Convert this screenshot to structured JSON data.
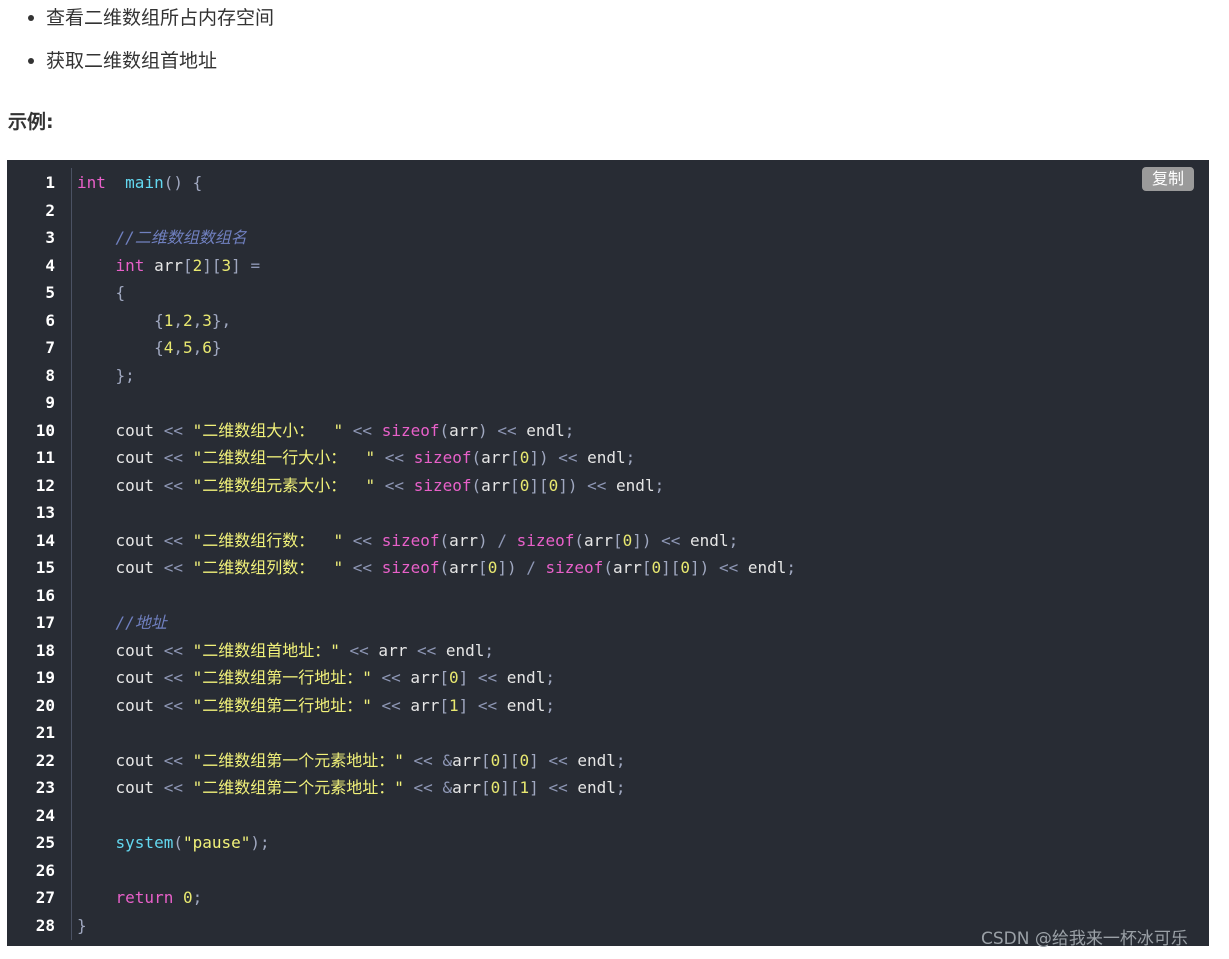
{
  "bullets": [
    "查看二维数组所占内存空间",
    "获取二维数组首地址"
  ],
  "heading": "示例:",
  "code": {
    "copy_label": "复制",
    "line_numbers": [
      "1",
      "2",
      "3",
      "4",
      "5",
      "6",
      "7",
      "8",
      "9",
      "10",
      "11",
      "12",
      "13",
      "14",
      "15",
      "16",
      "17",
      "18",
      "19",
      "20",
      "21",
      "22",
      "23",
      "24",
      "25",
      "26",
      "27",
      "28"
    ],
    "lines": [
      [
        [
          "kw",
          "int"
        ],
        [
          "",
          "  "
        ],
        [
          "fn",
          "main"
        ],
        [
          "pn",
          "() {"
        ]
      ],
      [],
      [
        [
          "",
          "    "
        ],
        [
          "cm",
          "//二维数组数组名"
        ]
      ],
      [
        [
          "",
          "    "
        ],
        [
          "kw",
          "int"
        ],
        [
          "",
          " arr"
        ],
        [
          "pn",
          "["
        ],
        [
          "num",
          "2"
        ],
        [
          "pn",
          "]["
        ],
        [
          "num",
          "3"
        ],
        [
          "pn",
          "]"
        ],
        [
          "",
          " "
        ],
        [
          "op",
          "="
        ]
      ],
      [
        [
          "",
          "    "
        ],
        [
          "pn",
          "{"
        ]
      ],
      [
        [
          "",
          "        "
        ],
        [
          "pn",
          "{"
        ],
        [
          "num",
          "1"
        ],
        [
          "pn",
          ","
        ],
        [
          "num",
          "2"
        ],
        [
          "pn",
          ","
        ],
        [
          "num",
          "3"
        ],
        [
          "pn",
          "},"
        ]
      ],
      [
        [
          "",
          "        "
        ],
        [
          "pn",
          "{"
        ],
        [
          "num",
          "4"
        ],
        [
          "pn",
          ","
        ],
        [
          "num",
          "5"
        ],
        [
          "pn",
          ","
        ],
        [
          "num",
          "6"
        ],
        [
          "pn",
          "}"
        ]
      ],
      [
        [
          "",
          "    "
        ],
        [
          "pn",
          "};"
        ]
      ],
      [],
      [
        [
          "",
          "    cout "
        ],
        [
          "op",
          "<<"
        ],
        [
          "",
          " "
        ],
        [
          "str",
          "\"二维数组大小：  \""
        ],
        [
          "",
          " "
        ],
        [
          "op",
          "<<"
        ],
        [
          "",
          " "
        ],
        [
          "kw",
          "sizeof"
        ],
        [
          "pn",
          "("
        ],
        [
          "",
          "arr"
        ],
        [
          "pn",
          ")"
        ],
        [
          "",
          " "
        ],
        [
          "op",
          "<<"
        ],
        [
          "",
          " endl"
        ],
        [
          "pn",
          ";"
        ]
      ],
      [
        [
          "",
          "    cout "
        ],
        [
          "op",
          "<<"
        ],
        [
          "",
          " "
        ],
        [
          "str",
          "\"二维数组一行大小：  \""
        ],
        [
          "",
          " "
        ],
        [
          "op",
          "<<"
        ],
        [
          "",
          " "
        ],
        [
          "kw",
          "sizeof"
        ],
        [
          "pn",
          "("
        ],
        [
          "",
          "arr"
        ],
        [
          "pn",
          "["
        ],
        [
          "num",
          "0"
        ],
        [
          "pn",
          "])"
        ],
        [
          "",
          " "
        ],
        [
          "op",
          "<<"
        ],
        [
          "",
          " endl"
        ],
        [
          "pn",
          ";"
        ]
      ],
      [
        [
          "",
          "    cout "
        ],
        [
          "op",
          "<<"
        ],
        [
          "",
          " "
        ],
        [
          "str",
          "\"二维数组元素大小：  \""
        ],
        [
          "",
          " "
        ],
        [
          "op",
          "<<"
        ],
        [
          "",
          " "
        ],
        [
          "kw",
          "sizeof"
        ],
        [
          "pn",
          "("
        ],
        [
          "",
          "arr"
        ],
        [
          "pn",
          "["
        ],
        [
          "num",
          "0"
        ],
        [
          "pn",
          "]["
        ],
        [
          "num",
          "0"
        ],
        [
          "pn",
          "])"
        ],
        [
          "",
          " "
        ],
        [
          "op",
          "<<"
        ],
        [
          "",
          " endl"
        ],
        [
          "pn",
          ";"
        ]
      ],
      [],
      [
        [
          "",
          "    cout "
        ],
        [
          "op",
          "<<"
        ],
        [
          "",
          " "
        ],
        [
          "str",
          "\"二维数组行数：  \""
        ],
        [
          "",
          " "
        ],
        [
          "op",
          "<<"
        ],
        [
          "",
          " "
        ],
        [
          "kw",
          "sizeof"
        ],
        [
          "pn",
          "("
        ],
        [
          "",
          "arr"
        ],
        [
          "pn",
          ")"
        ],
        [
          "",
          " "
        ],
        [
          "op",
          "/"
        ],
        [
          "",
          " "
        ],
        [
          "kw",
          "sizeof"
        ],
        [
          "pn",
          "("
        ],
        [
          "",
          "arr"
        ],
        [
          "pn",
          "["
        ],
        [
          "num",
          "0"
        ],
        [
          "pn",
          "])"
        ],
        [
          "",
          " "
        ],
        [
          "op",
          "<<"
        ],
        [
          "",
          " endl"
        ],
        [
          "pn",
          ";"
        ]
      ],
      [
        [
          "",
          "    cout "
        ],
        [
          "op",
          "<<"
        ],
        [
          "",
          " "
        ],
        [
          "str",
          "\"二维数组列数：  \""
        ],
        [
          "",
          " "
        ],
        [
          "op",
          "<<"
        ],
        [
          "",
          " "
        ],
        [
          "kw",
          "sizeof"
        ],
        [
          "pn",
          "("
        ],
        [
          "",
          "arr"
        ],
        [
          "pn",
          "["
        ],
        [
          "num",
          "0"
        ],
        [
          "pn",
          "])"
        ],
        [
          "",
          " "
        ],
        [
          "op",
          "/"
        ],
        [
          "",
          " "
        ],
        [
          "kw",
          "sizeof"
        ],
        [
          "pn",
          "("
        ],
        [
          "",
          "arr"
        ],
        [
          "pn",
          "["
        ],
        [
          "num",
          "0"
        ],
        [
          "pn",
          "]["
        ],
        [
          "num",
          "0"
        ],
        [
          "pn",
          "])"
        ],
        [
          "",
          " "
        ],
        [
          "op",
          "<<"
        ],
        [
          "",
          " endl"
        ],
        [
          "pn",
          ";"
        ]
      ],
      [],
      [
        [
          "",
          "    "
        ],
        [
          "cm",
          "//地址"
        ]
      ],
      [
        [
          "",
          "    cout "
        ],
        [
          "op",
          "<<"
        ],
        [
          "",
          " "
        ],
        [
          "str",
          "\"二维数组首地址：\""
        ],
        [
          "",
          " "
        ],
        [
          "op",
          "<<"
        ],
        [
          "",
          " arr "
        ],
        [
          "op",
          "<<"
        ],
        [
          "",
          " endl"
        ],
        [
          "pn",
          ";"
        ]
      ],
      [
        [
          "",
          "    cout "
        ],
        [
          "op",
          "<<"
        ],
        [
          "",
          " "
        ],
        [
          "str",
          "\"二维数组第一行地址：\""
        ],
        [
          "",
          " "
        ],
        [
          "op",
          "<<"
        ],
        [
          "",
          " arr"
        ],
        [
          "pn",
          "["
        ],
        [
          "num",
          "0"
        ],
        [
          "pn",
          "]"
        ],
        [
          "",
          " "
        ],
        [
          "op",
          "<<"
        ],
        [
          "",
          " endl"
        ],
        [
          "pn",
          ";"
        ]
      ],
      [
        [
          "",
          "    cout "
        ],
        [
          "op",
          "<<"
        ],
        [
          "",
          " "
        ],
        [
          "str",
          "\"二维数组第二行地址：\""
        ],
        [
          "",
          " "
        ],
        [
          "op",
          "<<"
        ],
        [
          "",
          " arr"
        ],
        [
          "pn",
          "["
        ],
        [
          "num",
          "1"
        ],
        [
          "pn",
          "]"
        ],
        [
          "",
          " "
        ],
        [
          "op",
          "<<"
        ],
        [
          "",
          " endl"
        ],
        [
          "pn",
          ";"
        ]
      ],
      [],
      [
        [
          "",
          "    cout "
        ],
        [
          "op",
          "<<"
        ],
        [
          "",
          " "
        ],
        [
          "str",
          "\"二维数组第一个元素地址：\""
        ],
        [
          "",
          " "
        ],
        [
          "op",
          "<<"
        ],
        [
          "",
          " "
        ],
        [
          "op",
          "&"
        ],
        [
          "",
          "arr"
        ],
        [
          "pn",
          "["
        ],
        [
          "num",
          "0"
        ],
        [
          "pn",
          "]["
        ],
        [
          "num",
          "0"
        ],
        [
          "pn",
          "]"
        ],
        [
          "",
          " "
        ],
        [
          "op",
          "<<"
        ],
        [
          "",
          " endl"
        ],
        [
          "pn",
          ";"
        ]
      ],
      [
        [
          "",
          "    cout "
        ],
        [
          "op",
          "<<"
        ],
        [
          "",
          " "
        ],
        [
          "str",
          "\"二维数组第二个元素地址：\""
        ],
        [
          "",
          " "
        ],
        [
          "op",
          "<<"
        ],
        [
          "",
          " "
        ],
        [
          "op",
          "&"
        ],
        [
          "",
          "arr"
        ],
        [
          "pn",
          "["
        ],
        [
          "num",
          "0"
        ],
        [
          "pn",
          "]["
        ],
        [
          "num",
          "1"
        ],
        [
          "pn",
          "]"
        ],
        [
          "",
          " "
        ],
        [
          "op",
          "<<"
        ],
        [
          "",
          " endl"
        ],
        [
          "pn",
          ";"
        ]
      ],
      [],
      [
        [
          "",
          "    "
        ],
        [
          "fn",
          "system"
        ],
        [
          "pn",
          "("
        ],
        [
          "str",
          "\"pause\""
        ],
        [
          "pn",
          ");"
        ]
      ],
      [],
      [
        [
          "",
          "    "
        ],
        [
          "kw",
          "return"
        ],
        [
          "",
          " "
        ],
        [
          "num",
          "0"
        ],
        [
          "pn",
          ";"
        ]
      ],
      [
        [
          "pn",
          "}"
        ]
      ]
    ]
  },
  "watermark": "CSDN @给我来一杯冰可乐",
  "colors": {
    "code_bg": "#282c34",
    "keyword": "#e860c9",
    "function": "#63d8f0",
    "string": "#f2f27a",
    "comment": "#7080c0"
  }
}
